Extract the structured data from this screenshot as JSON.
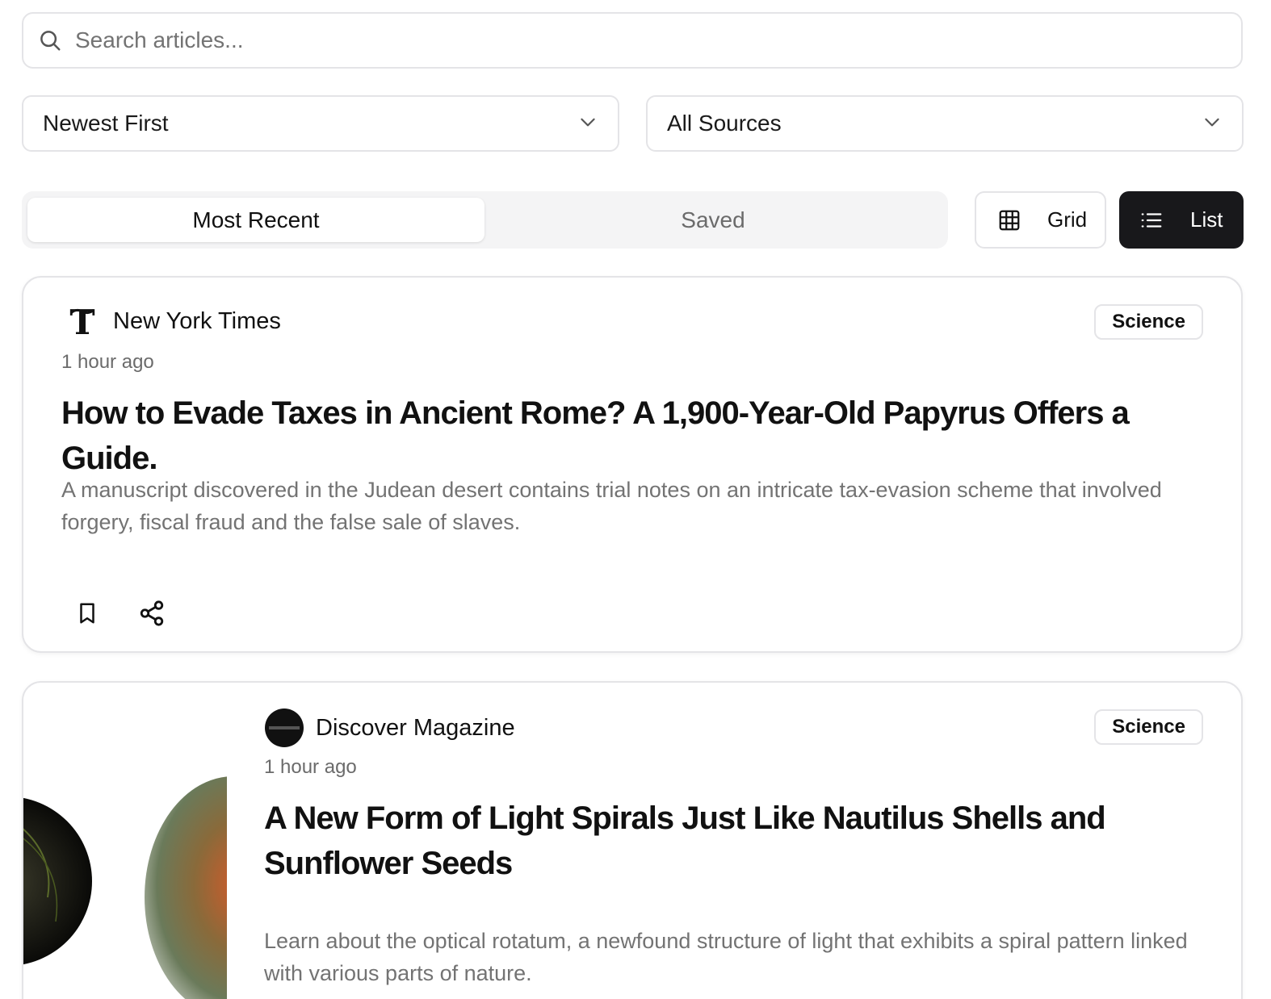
{
  "search": {
    "placeholder": "Search articles...",
    "value": ""
  },
  "filters": {
    "sort": {
      "selected": "Newest First"
    },
    "source": {
      "selected": "All Sources"
    }
  },
  "tabs": [
    {
      "label": "Most Recent",
      "active": true
    },
    {
      "label": "Saved",
      "active": false
    }
  ],
  "view_toggle": {
    "grid_label": "Grid",
    "list_label": "List",
    "active": "list"
  },
  "articles": [
    {
      "source": "New York Times",
      "time": "1 hour ago",
      "category": "Science",
      "title": "How to Evade Taxes in Ancient Rome? A 1,900-Year-Old Papyrus Offers a Guide.",
      "description": "A manuscript discovered in the Judean desert contains trial notes on an intricate tax-evasion scheme that involved forgery, fiscal fraud and the false sale of slaves."
    },
    {
      "source": "Discover Magazine",
      "time": "1 hour ago",
      "category": "Science",
      "title": "A New Form of Light Spirals Just Like Nautilus Shells and Sunflower Seeds",
      "description": "Learn about the optical rotatum, a newfound structure of light that exhibits a spiral pattern linked with various parts of nature."
    }
  ],
  "colors": {
    "active_button_bg": "#18181b",
    "border": "#e4e4e7",
    "muted_text": "#737373"
  }
}
